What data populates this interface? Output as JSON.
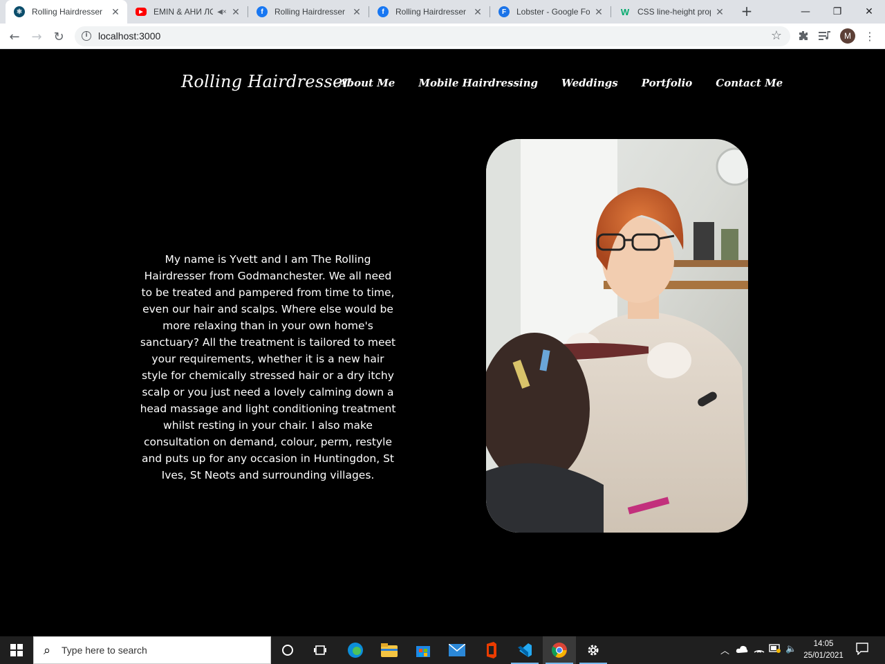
{
  "browser": {
    "tabs": [
      {
        "title": "Rolling Hairdresser",
        "favicon": "react-icon",
        "color": "#0b4d6b",
        "glyph": "⚛",
        "active": true
      },
      {
        "title": "EMIN & АНИ ЛО",
        "favicon": "youtube-icon",
        "color": "#ff0000",
        "glyph": "▶",
        "muted_icon": "🔇"
      },
      {
        "title": "Rolling Hairdresser | ",
        "favicon": "facebook-icon",
        "color": "#1877f2",
        "glyph": "f"
      },
      {
        "title": "Rolling Hairdresser | ",
        "favicon": "facebook-icon",
        "color": "#1877f2",
        "glyph": "f"
      },
      {
        "title": "Lobster - Google For",
        "favicon": "google-fonts-icon",
        "color": "#1a73e8",
        "glyph": "F"
      },
      {
        "title": "CSS line-height prop",
        "favicon": "w3schools-icon",
        "color": "#04aa6d",
        "glyph": "W"
      }
    ],
    "new_tab": "+",
    "address": "localhost:3000",
    "profile_initial": "M"
  },
  "site": {
    "brand": "Rolling Hairdresser",
    "nav": [
      "About Me",
      "Mobile Hairdressing",
      "Weddings",
      "Portfolio",
      "Contact Me"
    ],
    "about_text": "My name is Yvett and I am The Rolling Hairdresser from Godmanchester. We all need to be treated and pampered from time to time, even our hair and scalps. Where else would be more relaxing than in your own home's sanctuary? All the treatment is tailored to meet your requirements, whether it is a new hair style for chemically stressed hair or a dry itchy scalp or you just need a lovely calming down a head massage and light conditioning treatment whilst resting in your chair. I also make consultation on demand, colour, perm, restyle and puts up for any occasion in Huntingdon, St Ives, St Neots and surrounding villages."
  },
  "taskbar": {
    "search_placeholder": "Type here to search",
    "time": "14:05",
    "date": "25/01/2021"
  },
  "colors": {
    "page_bg": "#000000",
    "text": "#ffffff",
    "taskbar_bg": "#1f1f1f",
    "tabstrip_bg": "#dee1e6"
  }
}
